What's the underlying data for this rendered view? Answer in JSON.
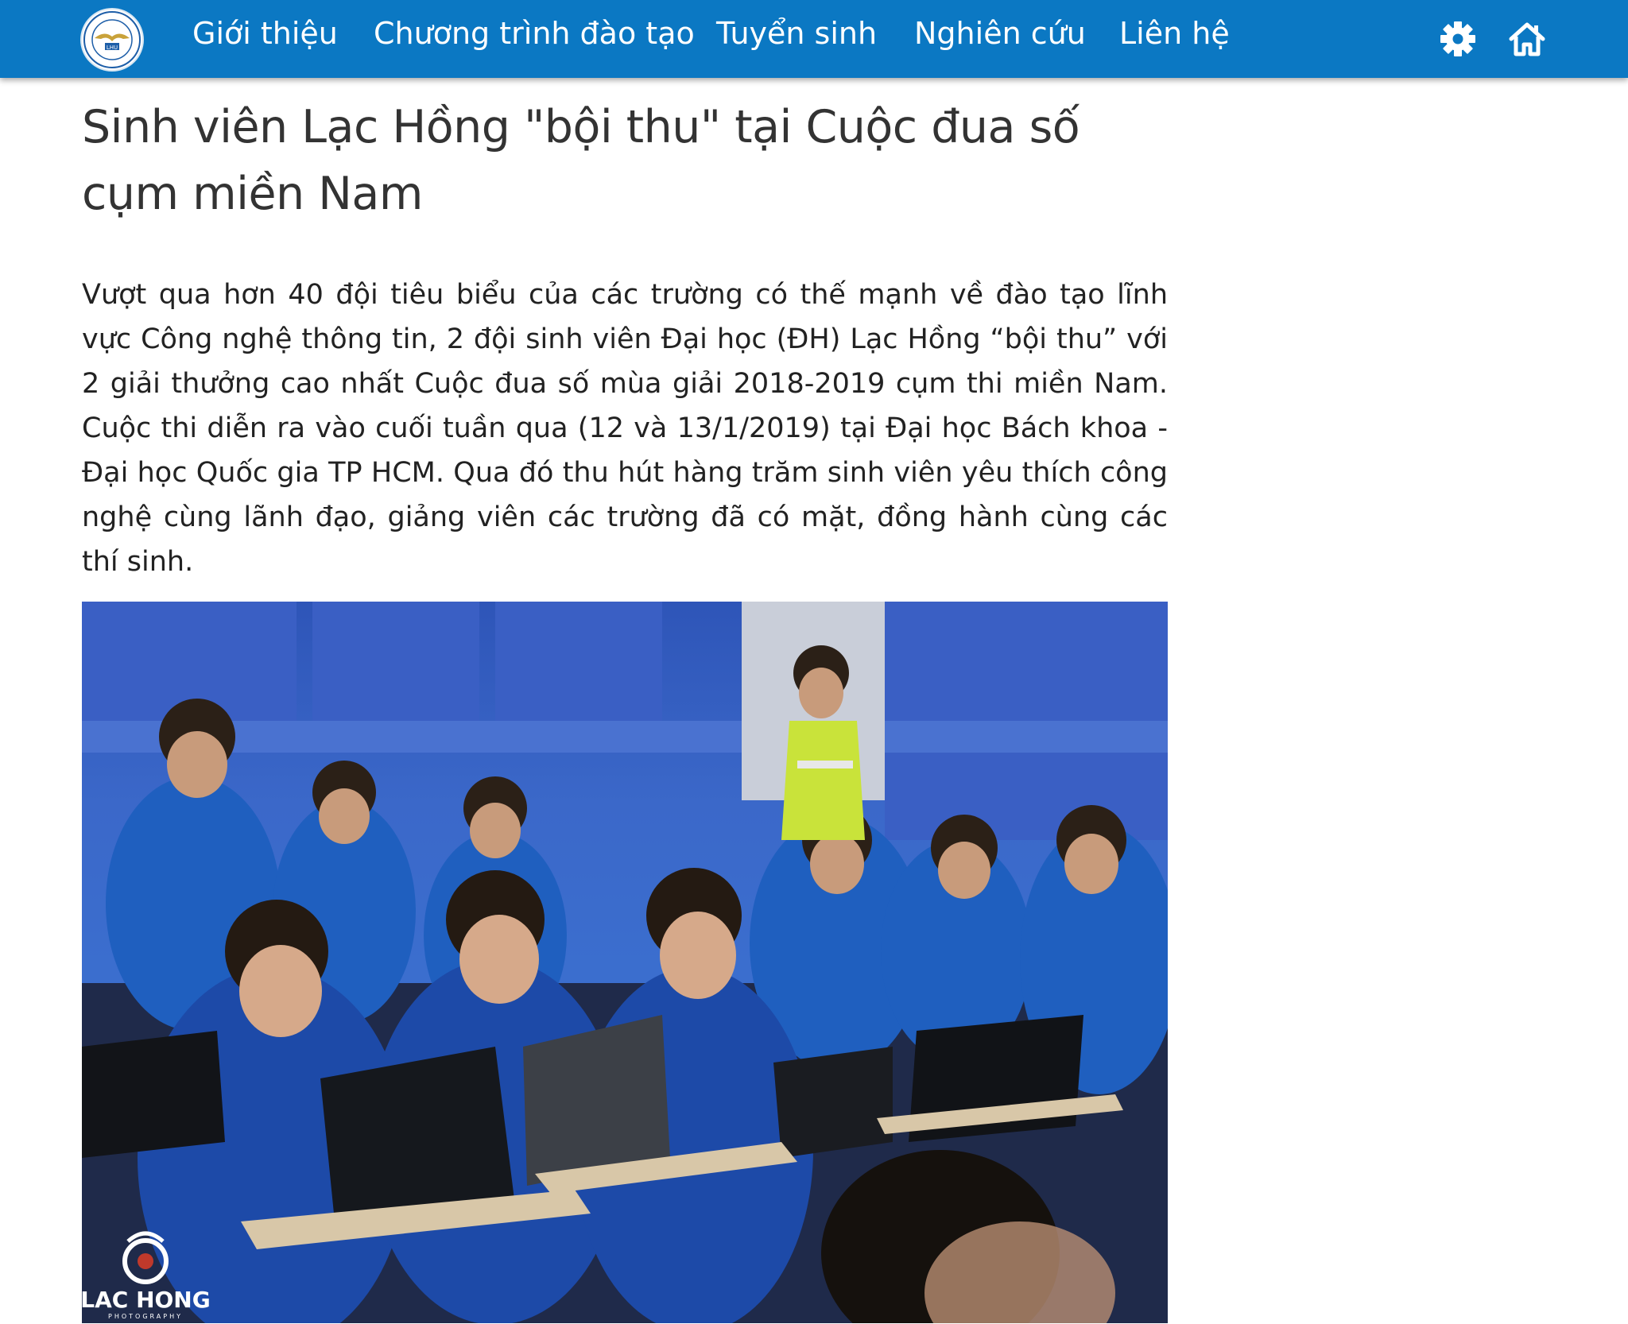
{
  "nav": {
    "items": [
      "Giới thiệu",
      "Chương trình đào tạo",
      "Tuyển sinh",
      "Nghiên cứu",
      "Liên hệ"
    ],
    "settings_icon": "gear-icon",
    "home_icon": "home-icon"
  },
  "article": {
    "title": "Sinh viên Lạc Hồng \"bội thu\" tại Cuộc đua số cụm miền Nam",
    "lead": "Vượt qua hơn 40 đội tiêu biểu của các trường có thế mạnh về đào tạo lĩnh vực Công nghệ thông tin, 2 đội sinh viên Đại học (ĐH) Lạc Hồng “bội thu” với 2 giải thưởng cao nhất Cuộc đua số mùa giải 2018-2019 cụm thi miền Nam. Cuộc thi diễn ra vào cuối tuần qua (12 và 13/1/2019) tại Đại học Bách khoa - Đại học Quốc gia TP HCM. Qua đó thu hút hàng trăm sinh viên yêu thích công nghệ cùng lãnh đạo, giảng viên các trường đã có mặt, đồng hành cùng các thí sinh.",
    "photo_watermark": "LAC HONG",
    "photo_watermark_sub": "PHOTOGRAPHY",
    "logo_text": "LHU"
  },
  "colors": {
    "navbar": "#0b78c3",
    "nav_text": "#ffffff",
    "title_text": "#333333"
  }
}
